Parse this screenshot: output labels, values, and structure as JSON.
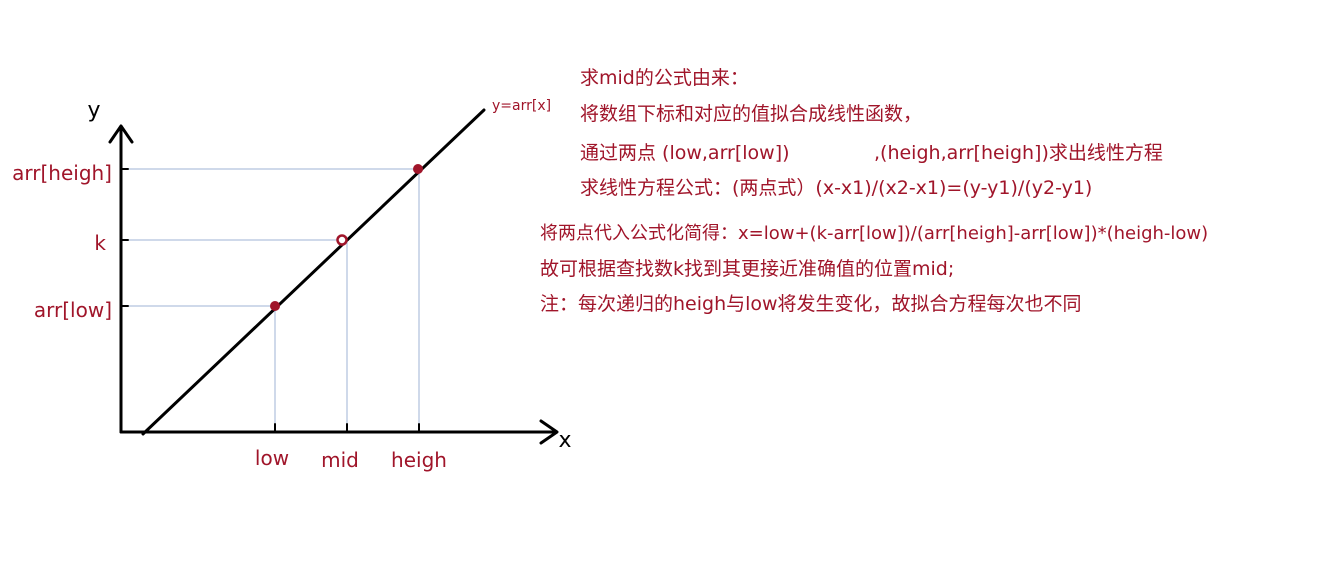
{
  "diagram": {
    "axis_y_label": "y",
    "axis_x_label": "x",
    "line_label": "y=arr[x]",
    "y_labels": {
      "high": "arr[heigh]",
      "mid": "k",
      "low": "arr[low]"
    },
    "x_labels": {
      "low": "low",
      "mid": "mid",
      "high": "heigh"
    },
    "colors": {
      "text": "#a0152a",
      "axis": "#000000",
      "guide": "#9fb3d6",
      "point": "#a0152a"
    }
  },
  "notes": {
    "title": "求mid的公式由来：",
    "line1": "将数组下标和对应的值拟合成线性函数，",
    "line2a": "通过两点 (low,arr[low])",
    "line2b": ",(heigh,arr[heigh])求出线性方程",
    "line3": "求线性方程公式：(两点式）(x-x1)/(x2-x1)=(y-y1)/(y2-y1)",
    "line4": "将两点代入公式化简得：x=low+(k-arr[low])/(arr[heigh]-arr[low])*(heigh-low)",
    "line5": "故可根据查找数k找到其更接近准确值的位置mid;",
    "line6": "注：每次递归的heigh与low将发生变化，故拟合方程每次也不同"
  }
}
